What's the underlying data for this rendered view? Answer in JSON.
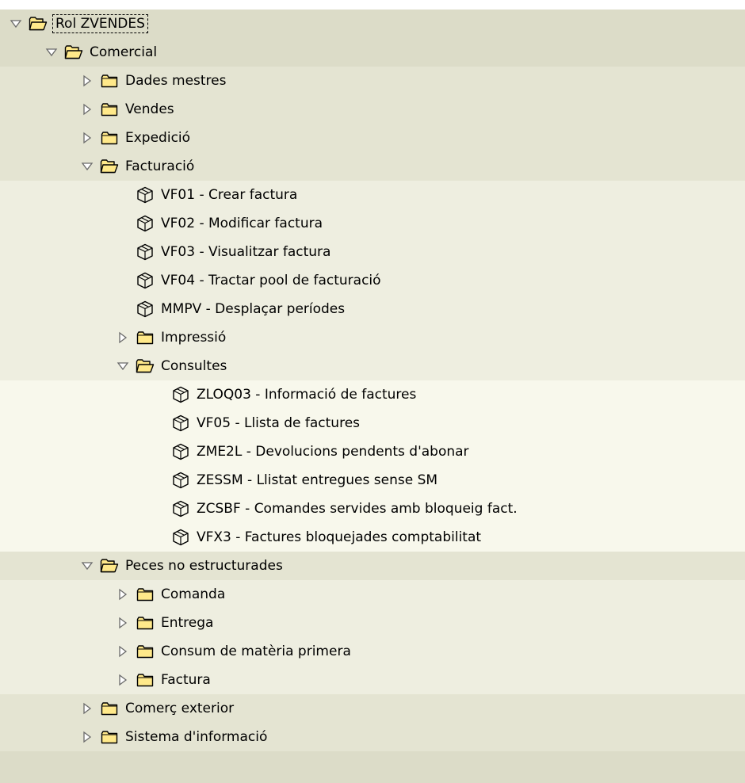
{
  "tree": [
    {
      "label": "Rol ZVENDES",
      "type": "folder",
      "expanded": true,
      "level": 0,
      "bg": 0,
      "selected": true
    },
    {
      "label": "Comercial",
      "type": "folder",
      "expanded": true,
      "level": 1,
      "bg": 1
    },
    {
      "label": "Dades mestres",
      "type": "folder",
      "expanded": false,
      "level": 2,
      "bg": 2
    },
    {
      "label": "Vendes",
      "type": "folder",
      "expanded": false,
      "level": 2,
      "bg": 2
    },
    {
      "label": "Expedició",
      "type": "folder",
      "expanded": false,
      "level": 2,
      "bg": 2
    },
    {
      "label": "Facturació",
      "type": "folder",
      "expanded": true,
      "level": 2,
      "bg": 2
    },
    {
      "label": "VF01 - Crear factura",
      "type": "transaction",
      "level": 3,
      "bg": 3
    },
    {
      "label": "VF02 - Modificar factura",
      "type": "transaction",
      "level": 3,
      "bg": 3
    },
    {
      "label": "VF03 - Visualitzar factura",
      "type": "transaction",
      "level": 3,
      "bg": 3
    },
    {
      "label": "VF04 - Tractar pool de facturació",
      "type": "transaction",
      "level": 3,
      "bg": 3
    },
    {
      "label": "MMPV - Desplaçar períodes",
      "type": "transaction",
      "level": 3,
      "bg": 3
    },
    {
      "label": "Impressió",
      "type": "folder",
      "expanded": false,
      "level": 3,
      "bg": 3
    },
    {
      "label": "Consultes",
      "type": "folder",
      "expanded": true,
      "level": 3,
      "bg": 3
    },
    {
      "label": "ZLOQ03 - Informació de factures",
      "type": "transaction",
      "level": 4,
      "bg": 4
    },
    {
      "label": "VF05 - Llista de factures",
      "type": "transaction",
      "level": 4,
      "bg": 4
    },
    {
      "label": "ZME2L - Devolucions pendents d'abonar",
      "type": "transaction",
      "level": 4,
      "bg": 4
    },
    {
      "label": "ZESSM - Llistat entregues sense SM",
      "type": "transaction",
      "level": 4,
      "bg": 4
    },
    {
      "label": "ZCSBF - Comandes servides amb bloqueig fact.",
      "type": "transaction",
      "level": 4,
      "bg": 4
    },
    {
      "label": "VFX3 - Factures bloquejades comptabilitat",
      "type": "transaction",
      "level": 4,
      "bg": 4
    },
    {
      "label": "Peces no estructurades",
      "type": "folder",
      "expanded": true,
      "level": 2,
      "bg": 2
    },
    {
      "label": "Comanda",
      "type": "folder",
      "expanded": false,
      "level": 3,
      "bg": 3
    },
    {
      "label": "Entrega",
      "type": "folder",
      "expanded": false,
      "level": 3,
      "bg": 3
    },
    {
      "label": "Consum de matèria primera",
      "type": "folder",
      "expanded": false,
      "level": 3,
      "bg": 3
    },
    {
      "label": "Factura",
      "type": "folder",
      "expanded": false,
      "level": 3,
      "bg": 3
    },
    {
      "label": "Comerç exterior",
      "type": "folder",
      "expanded": false,
      "level": 2,
      "bg": 2
    },
    {
      "label": "Sistema d'informació",
      "type": "folder",
      "expanded": false,
      "level": 2,
      "bg": 2
    }
  ],
  "icons": {
    "expanded": "triangle-down-icon",
    "collapsed": "triangle-right-icon",
    "folder_open": "folder-open-icon",
    "folder_closed": "folder-closed-icon",
    "transaction": "transaction-cube-icon"
  },
  "colors": {
    "folder_fill": "#ffe98a",
    "icon_stroke": "#000000",
    "toggle_stroke": "#6a6a6a"
  }
}
